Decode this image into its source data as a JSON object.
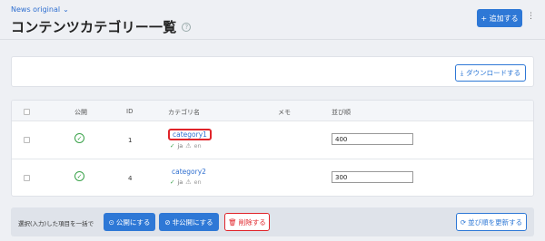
{
  "header": {
    "site_name": "News original",
    "page_title": "コンテンツカテゴリー一覧",
    "help_glyph": "?",
    "add_button": "+ 追加する",
    "menu_glyph": "⋮"
  },
  "download": {
    "label": "ダウンロードする",
    "icon": "⤓"
  },
  "table": {
    "columns": {
      "published": "公開",
      "id": "ID",
      "name": "カテゴリ名",
      "memo": "メモ",
      "order": "並び順"
    },
    "rows": [
      {
        "published_icon": "✓",
        "id": "1",
        "name": "category1",
        "lang_ok": "✓",
        "lang_ja": "ja",
        "lang_warn": "⚠",
        "lang_en": "en",
        "memo": "",
        "order": "400"
      },
      {
        "published_icon": "✓",
        "id": "4",
        "name": "category2",
        "lang_ok": "✓",
        "lang_ja": "ja",
        "lang_warn": "⚠",
        "lang_en": "en",
        "memo": "",
        "order": "300"
      }
    ]
  },
  "bulk": {
    "label": "選択(入力)した項目を一括で",
    "publish": "公開にする",
    "unpublish": "非公開にする",
    "delete": "削除する",
    "update_order": "並び順を更新する"
  },
  "colors": {
    "accent": "#2e78d6",
    "danger": "#e0242a",
    "success": "#3aa24a"
  }
}
